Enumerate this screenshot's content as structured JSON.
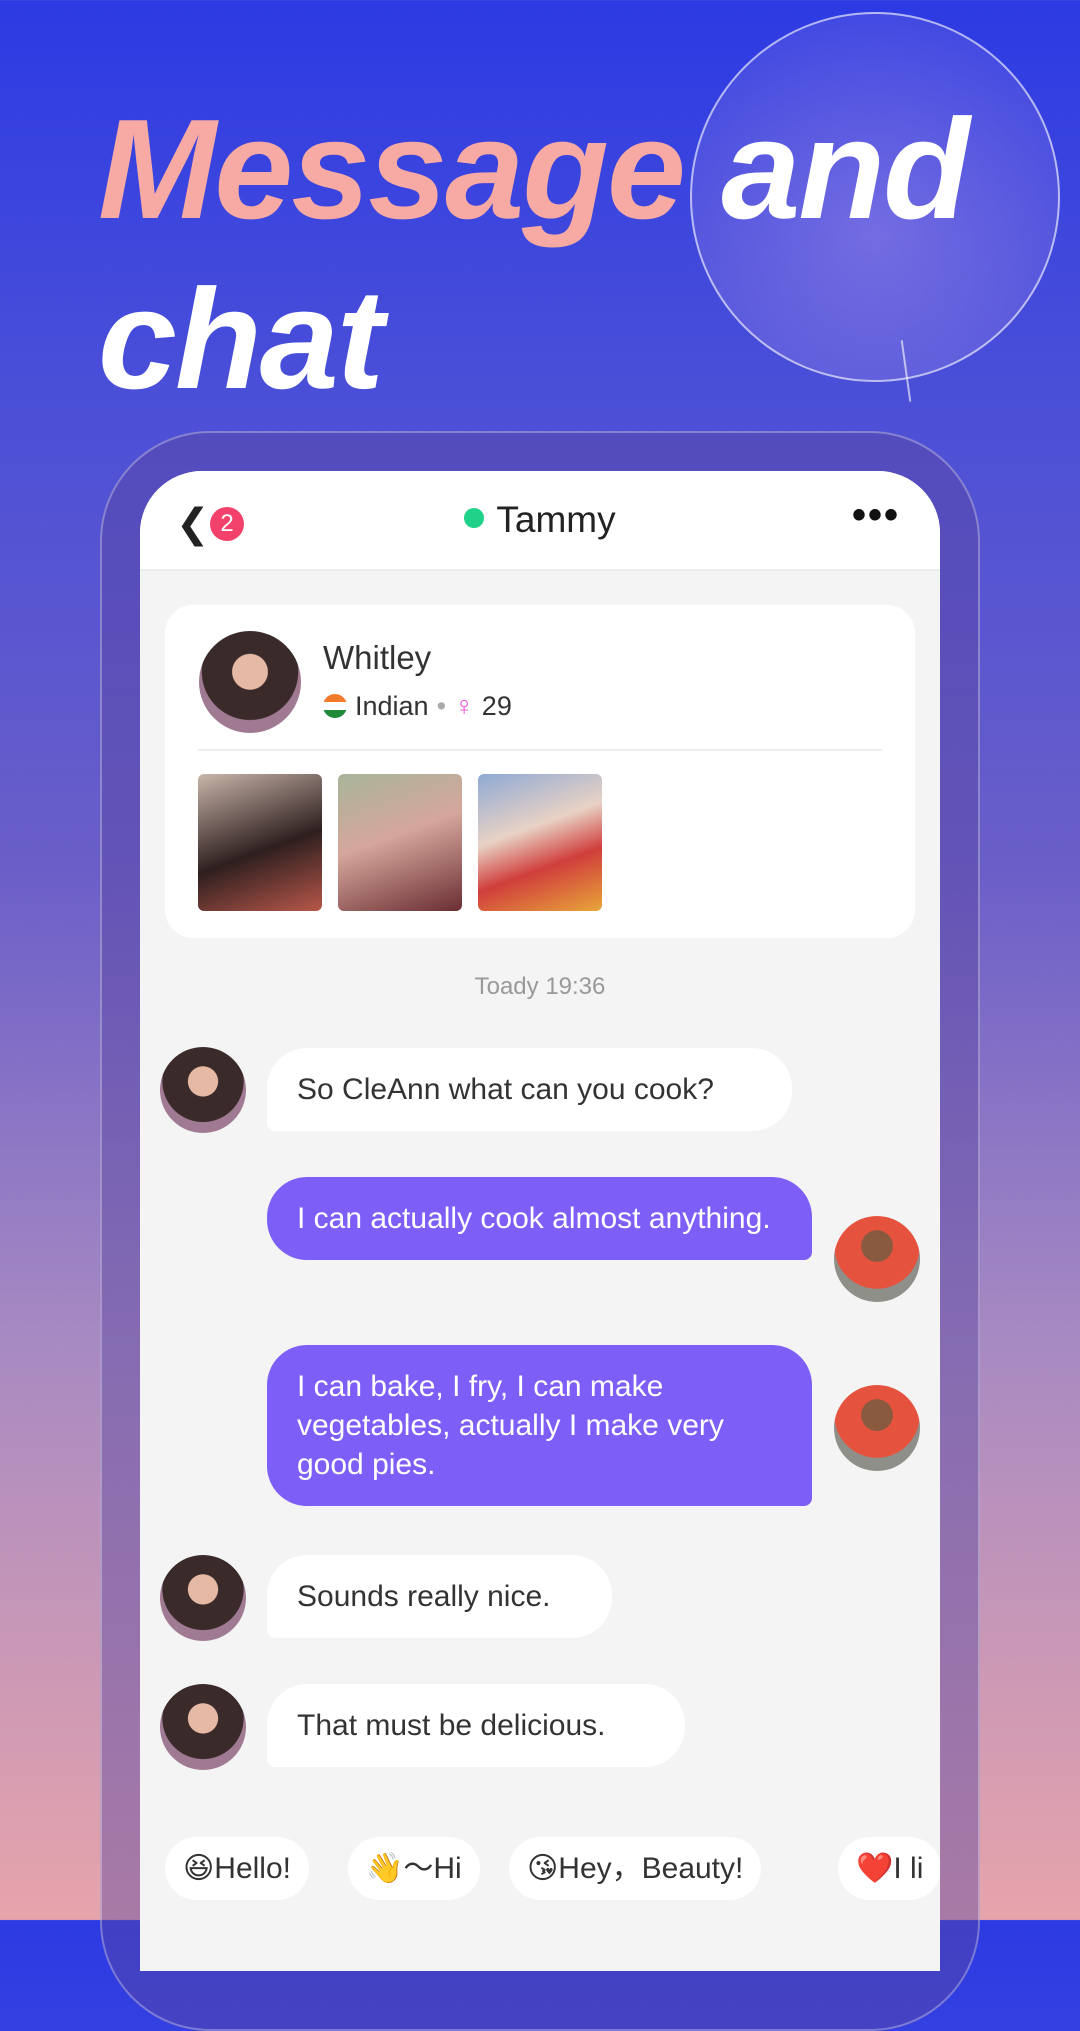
{
  "headline": {
    "highlight": "Message",
    "rest_line1": " and",
    "line2": "chat"
  },
  "chat": {
    "header": {
      "back_icon": "chevron-left",
      "unread_count": "2",
      "contact_name": "Tammy",
      "online_color": "#1fd189",
      "more_icon": "ellipsis"
    },
    "profile": {
      "name": "Whitley",
      "nationality": "Indian",
      "flag": "india-flag",
      "gender_symbol": "♀",
      "age": "29"
    },
    "timestamp": "Toady 19:36",
    "messages": [
      {
        "from": "them",
        "text": "So CleAnn what can you cook?"
      },
      {
        "from": "me",
        "text": "I can actually cook almost anything."
      },
      {
        "from": "me",
        "text": "I can bake, I fry, I can make vegetables, actually I make very good pies."
      },
      {
        "from": "them",
        "text": "Sounds really nice."
      },
      {
        "from": "them",
        "text": "That must be delicious."
      }
    ],
    "quick_replies": [
      "😆Hello!",
      "👋～Hi",
      "😘Hey，Beauty!",
      "❤️I li"
    ],
    "colors": {
      "outgoing_bubble": "#7d5ff7",
      "badge": "#f2416b"
    }
  }
}
